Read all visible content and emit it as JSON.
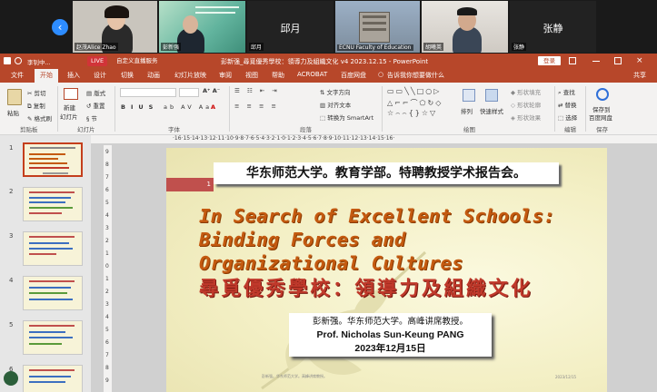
{
  "gallery": {
    "participants": [
      {
        "name": "赵茂Alice Zhao"
      },
      {
        "name": "彭新强"
      },
      {
        "name": "邱月",
        "caption": "邱月"
      },
      {
        "name": "ECNU Faculty of Education"
      },
      {
        "name": "胡曦英"
      },
      {
        "name": "张静",
        "caption": "张静"
      }
    ]
  },
  "titlebar": {
    "user": "李钊中...",
    "live": "LIVE",
    "present": "自定义直播服务",
    "title": "彭新强_尋覓優秀學校：領導力及組織文化 v4 2023.12.15  -  PowerPoint",
    "login": "登录"
  },
  "tabs": [
    "文件",
    "开始",
    "插入",
    "设计",
    "切换",
    "动画",
    "幻灯片放映",
    "审阅",
    "视图",
    "帮助",
    "ACROBAT",
    "百度网盘",
    "告诉我你想要做什么",
    "共享"
  ],
  "ribbon": {
    "paste": "粘贴",
    "cut": "剪切",
    "copy": "复制",
    "format_painter": "格式刷",
    "new_slide": "新建",
    "new_slide2": "幻灯片",
    "layout": "版式",
    "reset": "重置",
    "section": "节",
    "text_direction": "文字方向",
    "align_text": "对齐文本",
    "smartart": "转换为 SmartArt",
    "arrange": "排列",
    "quick_styles": "快速样式",
    "shape_fill": "形状填充",
    "shape_outline": "形状轮廓",
    "shape_effects": "形状效果",
    "find": "查找",
    "replace": "替换",
    "select": "选择",
    "save_to": "保存到",
    "baidu": "百度网盘",
    "groups": {
      "clipboard": "剪贴板",
      "slides": "幻灯片",
      "font": "字体",
      "paragraph": "段落",
      "drawing": "绘图",
      "editing": "编辑",
      "save": "保存"
    }
  },
  "ruler_h": "·16·15·14·13·12·11·10·9·8·7·6·5·4·3·2·1·0·1·2·3·4·5·6·7·8·9·10·11·12·13·14·15·16·",
  "ruler_v": [
    "9",
    "8",
    "7",
    "6",
    "5",
    "4",
    "3",
    "2",
    "1",
    "0",
    "1",
    "2",
    "3",
    "4",
    "5",
    "6",
    "7",
    "8",
    "9"
  ],
  "thumbnails": [
    1,
    2,
    3,
    4,
    5,
    6
  ],
  "slide": {
    "number": "1",
    "header": "华东师范大学。教育学部。特聘教授学术报告会。",
    "title_en_1": "In Search of Excellent Schools:",
    "title_en_2": "Binding Forces and",
    "title_en_3": "Organizational Cultures",
    "title_cn": "尋覓優秀學校：領導力及組織文化",
    "speaker_cn": "彭新强。华东师范大学。高峰讲席教授。",
    "speaker_en": "Prof. Nicholas Sun-Keung PANG",
    "date": "2023年12月15日",
    "footer_left": "彭新强。华东师范大学。高峰讲席教授。",
    "footer_right": "2023/12/15"
  }
}
